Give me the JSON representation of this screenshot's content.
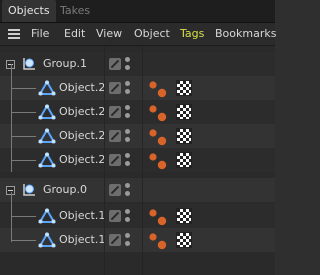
{
  "tabs": [
    {
      "label": "Objects"
    },
    {
      "label": "Takes"
    }
  ],
  "menu": {
    "items": [
      "File",
      "Edit",
      "View",
      "Object",
      "Tags",
      "Bookmarks"
    ],
    "tags_color": "#d7e04a"
  },
  "outliner": {
    "rows": [
      {
        "name": "Group.1",
        "kind": "group",
        "depth": 0
      },
      {
        "name": "Object.2",
        "kind": "object",
        "depth": 1
      },
      {
        "name": "Object.2",
        "kind": "object",
        "depth": 1
      },
      {
        "name": "Object.2",
        "kind": "object",
        "depth": 1
      },
      {
        "name": "Object.2",
        "kind": "object",
        "depth": 1
      },
      {
        "name": "Group.0",
        "kind": "group",
        "depth": 0
      },
      {
        "name": "Object.1",
        "kind": "object",
        "depth": 1
      },
      {
        "name": "Object.1",
        "kind": "object",
        "depth": 1
      }
    ]
  },
  "icons": {
    "hamburger": "menu-icon",
    "edit": "edit-icon",
    "visibility": "visibility-dots-icon",
    "tag_material": "material-tag-icon",
    "tag_texture": "checker-texture-icon"
  },
  "colors": {
    "accent_blue": "#5aa6ff",
    "tag_orange": "#d8642a",
    "checker_light": "#ffffff",
    "checker_dark": "#222222"
  }
}
